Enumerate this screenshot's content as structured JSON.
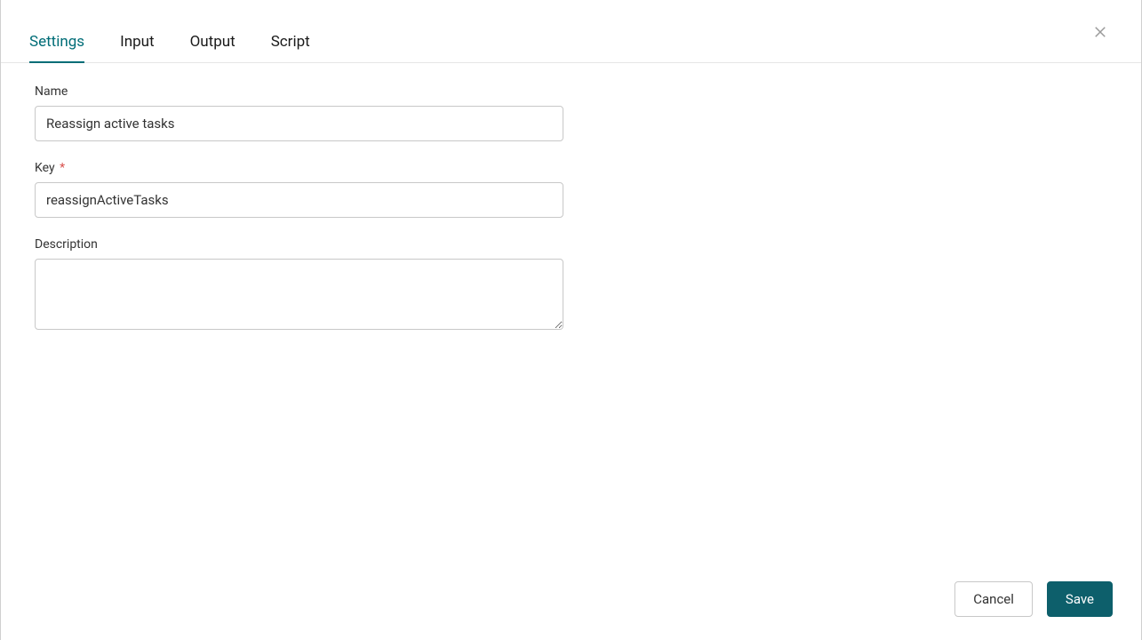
{
  "tabs": [
    {
      "label": "Settings",
      "active": true
    },
    {
      "label": "Input",
      "active": false
    },
    {
      "label": "Output",
      "active": false
    },
    {
      "label": "Script",
      "active": false
    }
  ],
  "form": {
    "name": {
      "label": "Name",
      "value": "Reassign active tasks",
      "required": false
    },
    "key": {
      "label": "Key",
      "value": "reassignActiveTasks",
      "required": true
    },
    "description": {
      "label": "Description",
      "value": "",
      "required": false
    }
  },
  "footer": {
    "cancel_label": "Cancel",
    "save_label": "Save"
  },
  "required_mark": "*"
}
